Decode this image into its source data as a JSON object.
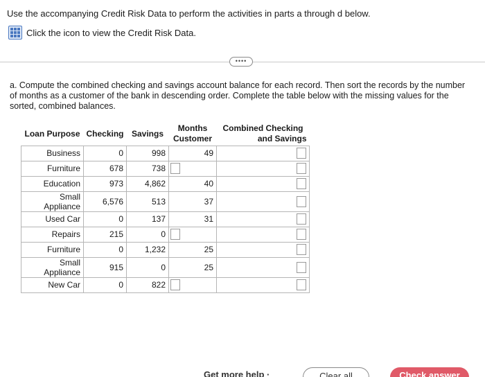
{
  "instructions": "Use the accompanying Credit Risk Data to perform the activities in parts a through d below.",
  "data_link": {
    "icon": "spreadsheet-icon",
    "label": "Click the icon to view the Credit Risk Data."
  },
  "expand_button": "••••",
  "question": "a. Compute the combined checking and savings account balance for each record. Then sort the records by the number of months as a customer of the bank in descending order. Complete the table below with the missing values for the sorted, combined balances.",
  "table": {
    "headers": {
      "purpose": "Loan Purpose",
      "checking": "Checking",
      "savings": "Savings",
      "months_line1": "Months",
      "months_line2": "Customer",
      "combined_line1": "Combined Checking",
      "combined_line2": "and Savings"
    },
    "rows": [
      {
        "purpose": "Business",
        "checking": "0",
        "savings": "998",
        "months": "49"
      },
      {
        "purpose": "Furniture",
        "checking": "678",
        "savings": "738",
        "months": ""
      },
      {
        "purpose": "Education",
        "checking": "973",
        "savings": "4,862",
        "months": "40"
      },
      {
        "purpose": "Small Appliance",
        "checking": "6,576",
        "savings": "513",
        "months": "37"
      },
      {
        "purpose": "Used Car",
        "checking": "0",
        "savings": "137",
        "months": "31"
      },
      {
        "purpose": "Repairs",
        "checking": "215",
        "savings": "0",
        "months": ""
      },
      {
        "purpose": "Furniture",
        "checking": "0",
        "savings": "1,232",
        "months": "25"
      },
      {
        "purpose": "Small Appliance",
        "checking": "915",
        "savings": "0",
        "months": "25"
      },
      {
        "purpose": "New Car",
        "checking": "0",
        "savings": "822",
        "months": ""
      }
    ]
  },
  "footer": {
    "help": "Get more help ·",
    "clear_all": "Clear all",
    "check_answer": "Check answer"
  },
  "colors": {
    "check_button": "#e05a68",
    "icon_blue": "#4a78c0"
  }
}
